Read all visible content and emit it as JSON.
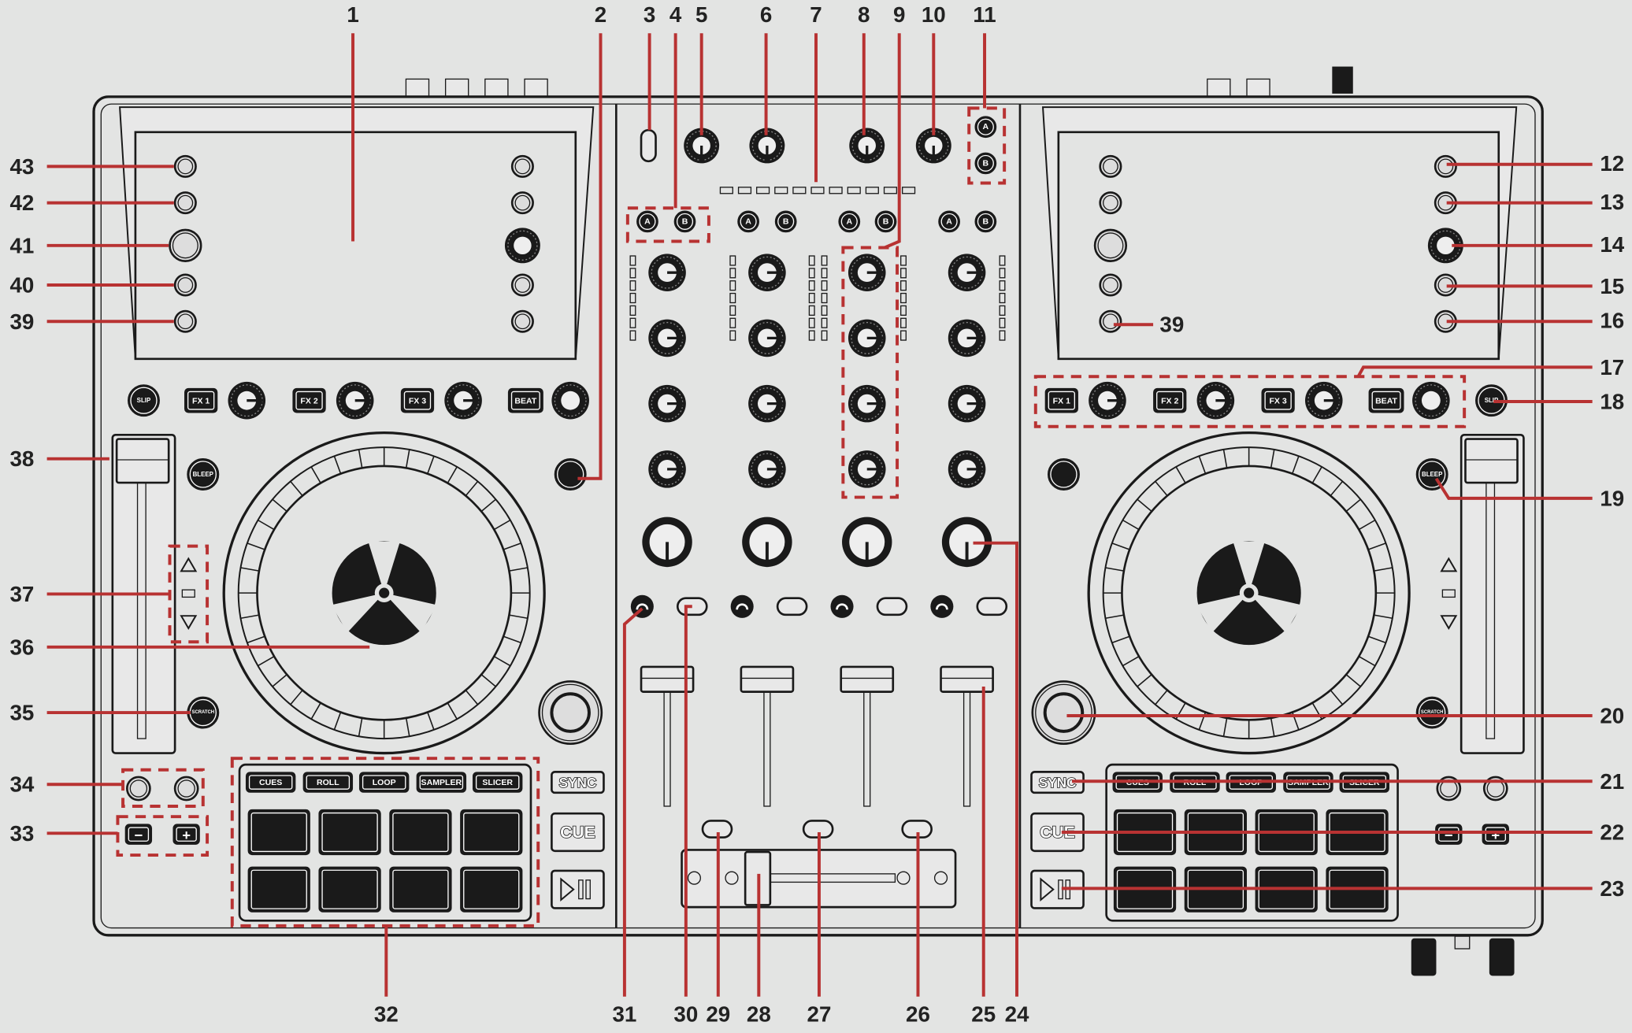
{
  "colors": {
    "background": "#e3e4e3",
    "callout": "#b83232",
    "outline": "#1a1a1a",
    "button_fill": "#0d0d0d"
  },
  "callouts": [
    "1",
    "2",
    "3",
    "4",
    "5",
    "6",
    "7",
    "8",
    "9",
    "10",
    "11",
    "12",
    "13",
    "14",
    "15",
    "16",
    "17",
    "18",
    "19",
    "20",
    "21",
    "22",
    "23",
    "24",
    "25",
    "26",
    "27",
    "28",
    "29",
    "30",
    "31",
    "32",
    "33",
    "34",
    "35",
    "36",
    "37",
    "38",
    "39",
    "40",
    "41",
    "42",
    "43",
    "39"
  ],
  "deck_left": {
    "slip": "SLIP",
    "fx": [
      "FX 1",
      "FX 2",
      "FX 3"
    ],
    "beat": "BEAT",
    "bleep": "BLEEP",
    "scratch": "SCRATCH",
    "pad_modes": [
      "CUES",
      "ROLL",
      "LOOP",
      "SAMPLER",
      "SLICER"
    ],
    "sync": "SYNC",
    "cue": "CUE",
    "minus": "−",
    "plus": "+"
  },
  "deck_right": {
    "slip": "SLIP",
    "fx": [
      "FX 1",
      "FX 2",
      "FX 3"
    ],
    "beat": "BEAT",
    "bleep": "BLEEP",
    "scratch": "SCRATCH",
    "pad_modes": [
      "CUES",
      "ROLL",
      "LOOP",
      "SAMPLER",
      "SLICER"
    ],
    "sync": "SYNC",
    "cue": "CUE",
    "minus": "−",
    "plus": "+"
  },
  "mixer": {
    "assign_a": "A",
    "assign_b": "B"
  },
  "icons": [
    "hand-fx-icon",
    "headphone-icon",
    "play-pause-icon",
    "record-label-icon",
    "arrow-up-icon",
    "arrow-down-icon"
  ]
}
